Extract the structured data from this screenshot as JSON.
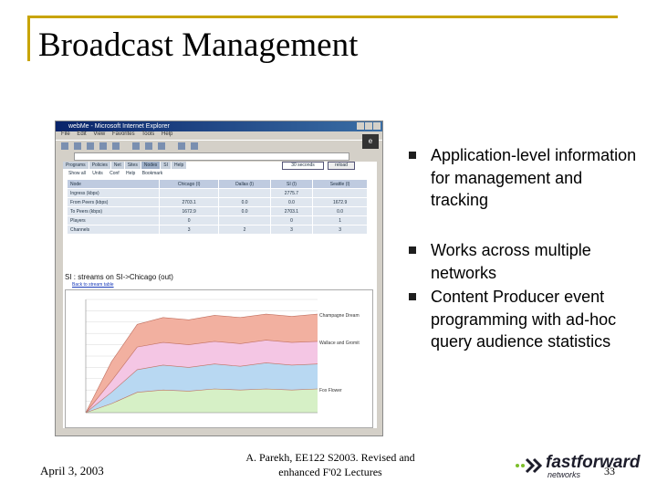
{
  "slide": {
    "title": "Broadcast Management",
    "bullets": [
      "Application-level information for management and tracking",
      "Works across multiple networks",
      "Content Producer event programming with ad-hoc query audience statistics"
    ],
    "footer": {
      "date": "April 3, 2003",
      "credit_line1": "A. Parekh, EE122 S2003. Revised and",
      "credit_line2": "enhanced F'02 Lectures",
      "page_number": "33"
    },
    "logo": {
      "brand": "fastforward",
      "sub": "networks"
    },
    "colors": {
      "frame": "#c8a400",
      "bullet": "#1e1e1e"
    }
  },
  "screenshot": {
    "window_title": "webMe - Microsoft Internet Explorer",
    "menu": [
      "File",
      "Edit",
      "View",
      "Favorites",
      "Tools",
      "Help"
    ],
    "tabs": [
      "Programs",
      "Policies",
      "Net",
      "Sites",
      "Nodes",
      "SI",
      "Help"
    ],
    "selected_tab": "Nodes",
    "select_value": "30 seconds",
    "refresh_label": "reload",
    "subnav": [
      "Show all",
      "Units",
      "Conf",
      "Help",
      "Bookmark"
    ],
    "table": {
      "headers": [
        "Node",
        "Chicago (I)",
        "Dallas (I)",
        "SI (I)",
        "Seattle (I)"
      ],
      "rows": [
        [
          "Ingress (kbps)",
          "",
          "",
          "2775.7",
          ""
        ],
        [
          "From Peers (kbps)",
          "2703.1",
          "0.0",
          "0.0",
          "1672.9"
        ],
        [
          "To Peers (kbps)",
          "1672.9",
          "0.0",
          "2703.1",
          "0.0"
        ],
        [
          "Players",
          "0",
          "",
          "0",
          "1"
        ],
        [
          "Channels",
          "3",
          "2",
          "3",
          "3"
        ]
      ]
    },
    "stream_title": "SI : streams on SI->Chicago (out)",
    "stream_link": "Back to stream table",
    "chart_data": {
      "type": "area",
      "series": [
        {
          "name": "Champagne Dream",
          "color": "#f2b0a0",
          "values": [
            0,
            0.45,
            0.78,
            0.84,
            0.82,
            0.86,
            0.84,
            0.87,
            0.85,
            0.87
          ]
        },
        {
          "name": "Wallace and Gromit",
          "color": "#f4c6e4",
          "values": [
            0,
            0.28,
            0.58,
            0.62,
            0.6,
            0.63,
            0.61,
            0.64,
            0.62,
            0.63
          ]
        },
        {
          "name": "",
          "color": "#b8d8f2",
          "values": [
            0,
            0.18,
            0.38,
            0.42,
            0.4,
            0.43,
            0.41,
            0.44,
            0.42,
            0.43
          ]
        },
        {
          "name": "Fox Flower",
          "color": "#d6f0c6",
          "values": [
            0,
            0.08,
            0.18,
            0.2,
            0.19,
            0.21,
            0.2,
            0.21,
            0.2,
            0.21
          ]
        }
      ],
      "ylim": [
        0,
        1
      ]
    }
  }
}
